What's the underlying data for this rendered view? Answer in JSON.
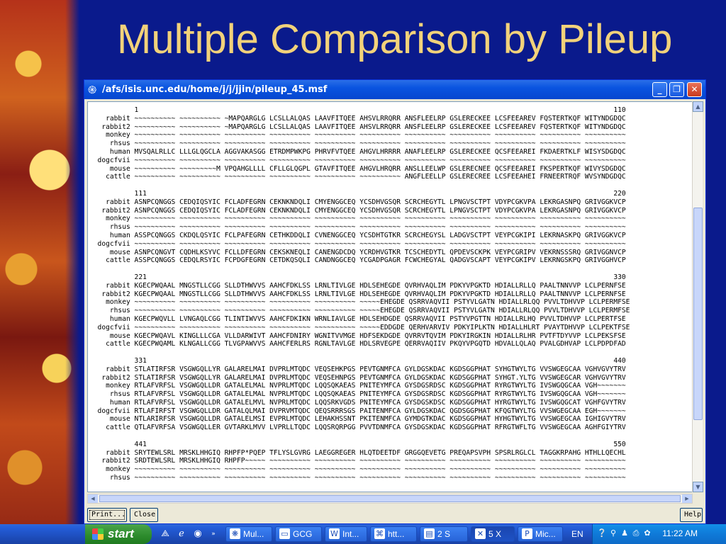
{
  "slide": {
    "title": "Multiple Comparison by Pileup"
  },
  "window": {
    "title": "/afs/isis.unc.edu/home/j/j/jjin/pileup_45.msf",
    "buttons": {
      "minimize": "_",
      "maximize": "❐",
      "close": "✕"
    }
  },
  "alignment": {
    "blocks": [
      {
        "start": "1",
        "end": "110",
        "rows": [
          [
            "rabbit",
            "~~~~~~~~~~ ~~~~~~~~~~ ~MAPQARGLG LCSLLALQAS LAAVFITQEE AHSVLRRQRR ANSFLEELRP GSLERECKEE LCSFEEAREV FQSTERTKQF WITYNDGDQC"
          ],
          [
            "rabbit2",
            "~~~~~~~~~~ ~~~~~~~~~~ ~MAPQARGLG LCSLLALQAS LAAVFITQEE AHSVLRRQRR ANSFLEELRP GSLERECKEE LCSFEEAREV FQSTERTKQF WITYNDGDQC"
          ],
          [
            "monkey",
            "~~~~~~~~~~ ~~~~~~~~~~ ~~~~~~~~~~ ~~~~~~~~~~ ~~~~~~~~~~ ~~~~~~~~~~ ~~~~~~~~~~ ~~~~~~~~~~ ~~~~~~~~~~ ~~~~~~~~~~ ~~~~~~~~~~"
          ],
          [
            "rhsus",
            "~~~~~~~~~~ ~~~~~~~~~~ ~~~~~~~~~~ ~~~~~~~~~~ ~~~~~~~~~~ ~~~~~~~~~~ ~~~~~~~~~~ ~~~~~~~~~~ ~~~~~~~~~~ ~~~~~~~~~~ ~~~~~~~~~~"
          ],
          [
            "human",
            "MVSQALRLLC LLLGLQGCLA AGGVAKASGG ETRDMPWKPG PHRVFVTQEE AHGVLHRRRR ANAFLEELRP GSLERECKEE QCSFEEAREI FKDAERTKLF WISYSDGDQC"
          ],
          [
            "dogcfvii",
            "~~~~~~~~~~ ~~~~~~~~~~ ~~~~~~~~~~ ~~~~~~~~~~ ~~~~~~~~~~ ~~~~~~~~~~ ~~~~~~~~~~ ~~~~~~~~~~ ~~~~~~~~~~ ~~~~~~~~~~ ~~~~~~~~~~"
          ],
          [
            "mouse",
            "~~~~~~~~~~ ~~~~~~~~~M VPQAHGLLLL CFLLGLQGPL GTAVFITQEE AHGVLHRQRR ANSLLEELWP GSLERECNEE QCSFEEAREI FKSPERTKQF WIVYSDGDQC"
          ],
          [
            "cattle",
            "~~~~~~~~~~ ~~~~~~~~~~ ~~~~~~~~~~ ~~~~~~~~~~ ~~~~~~~~~~ ~~~~~~~~~~ ANGFLEELLP GSLERECREE LCSFEEAHEI FRNEERTRQF WVSYNDGDQC"
          ]
        ]
      },
      {
        "start": "111",
        "end": "220",
        "rows": [
          [
            "rabbit",
            "ASNPCQNGGS CEDQIQSYIC FCLADFEGRN CEKNKNDQLI CMYENGGCEQ YCSDHVGSQR SCRCHEGYTL LPNGVSCTPT VDYPCGKVPA LEKRGASNPQ GRIVGGKVCP"
          ],
          [
            "rabbit2",
            "ASNPCQNGGS CEDQIQSYIC FCLADFEGRN CEKNKNDQLI CMYENGGCEQ YCSDHVGSQR SCRCHEGYTL LPNGVSCTPT VDYPCGKVPA LEKRGASNPQ GRIVGGKVCP"
          ],
          [
            "monkey",
            "~~~~~~~~~~ ~~~~~~~~~~ ~~~~~~~~~~ ~~~~~~~~~~ ~~~~~~~~~~ ~~~~~~~~~~ ~~~~~~~~~~ ~~~~~~~~~~ ~~~~~~~~~~ ~~~~~~~~~~ ~~~~~~~~~~"
          ],
          [
            "rhsus",
            "~~~~~~~~~~ ~~~~~~~~~~ ~~~~~~~~~~ ~~~~~~~~~~ ~~~~~~~~~~ ~~~~~~~~~~ ~~~~~~~~~~ ~~~~~~~~~~ ~~~~~~~~~~ ~~~~~~~~~~ ~~~~~~~~~~"
          ],
          [
            "human",
            "ASSPCQNGGS CKDQLQSYIC FCLPAFEGRN CETHKDDQLI CVNENGGCEQ YCSDHTGTKR SCRCHEGYSL LADGVSCTPT VEYPCGKIPI LEKRNASKPQ GRIVGGKVCP"
          ],
          [
            "dogcfvii",
            "~~~~~~~~~~ ~~~~~~~~~~ ~~~~~~~~~~ ~~~~~~~~~~ ~~~~~~~~~~ ~~~~~~~~~~ ~~~~~~~~~~ ~~~~~~~~~~ ~~~~~~~~~~ ~~~~~~~~~~ ~~~~~~~~~~"
          ],
          [
            "mouse",
            "ASNPCQNGVT CQDHLKSYVC FCLLDFEGRN CEKSKNEQLI CANENGDCDQ YCRDHVGTKR TCSCHEDYTL QPDEVSCKPK VEYPCGRIPV VEKRNSSSRQ GRIVGGNVCP"
          ],
          [
            "cattle",
            "ASSPCQNGGS CEDQLRSYIC FCPDGFEGRN CETDKQSQLI CANDNGGCEQ YCGADPGAGR FCWCHEGYAL QADGVSCAPT VEYPCGKIPV LEKRNGSKPQ GRIVGGHVCP"
          ]
        ]
      },
      {
        "start": "221",
        "end": "330",
        "rows": [
          [
            "rabbit",
            "KGECPWQAAL MNGSTLLCGG SLLDTHWVVS AAHCFDKLSS LRNLTIVLGE HDLSEHEGDE QVRHVAQLIM PDKYVPGKTD HDIALLRLLQ PAALTNNVVP LCLPERNFSE"
          ],
          [
            "rabbit2",
            "KGECPWQAAL MNGSTLLCGG SLLDTHWVVS AAHCFDKLSS LRNLTIVLGE HDLSEHEGDE QVRHVAQLIM PDKYVPGKTD HDIALLRLLQ PAALTNNVVP LCLPERNFSE"
          ],
          [
            "monkey",
            "~~~~~~~~~~ ~~~~~~~~~~ ~~~~~~~~~~ ~~~~~~~~~~ ~~~~~~~~~~ ~~~~~EHEGDE QSRRVAQVII PSTYVLGATN HDIALLRLQQ PVVLTDHVVP LCLPERMFSE"
          ],
          [
            "rhsus",
            "~~~~~~~~~~ ~~~~~~~~~~ ~~~~~~~~~~ ~~~~~~~~~~ ~~~~~~~~~~ ~~~~~EHEGDE QSRRVAQVII PSTYVLGATN HDIALLRLQQ PVVLTDHVVP LCLPERMFSE"
          ],
          [
            "human",
            "KGECPWQVLL LVNGAQLCGG TLINTIWVVS AAHCFDKIKN WRNLIAVLGE HDLSEHDGDE QSRRVAQVII PSTYVPGTTN HDIALLRLHQ PVVLTDHVVP LCLPERTFSE"
          ],
          [
            "dogcfvii",
            "~~~~~~~~~~ ~~~~~~~~~~ ~~~~~~~~~~ ~~~~~~~~~~ ~~~~~~~~~~ ~~~~~EDDGDE QERHVARVIV PDKYIPLKTN HDIALLHLRT PVAYTDHVVP LCLPEKTFSE"
          ],
          [
            "mouse",
            "KGECPWQAVL KINGLLLCGA VLLDARWIVT AAHCFDNIRY WGNITVVMGE HDFSEKDGDE QVRRVTQVIM PDKYIRGKIN HDIALLRLHR PVTFTDYVVP LCLPEKSFSE"
          ],
          [
            "cattle",
            "KGECPWQAML KLNGALLCGG TLVGPAWVVS AAHCFERLRS RGNLTAVLGE HDLSRVEGPE QERRVAQIIV PKQYVPGQTD HDVALLQLAQ PVALGDHVAP LCLPDPDFAD"
          ]
        ]
      },
      {
        "start": "331",
        "end": "440",
        "rows": [
          [
            "rabbit",
            "STLATIRFSR VSGWGQLLYR GALARELMAI DVPRLMTQDC VEQSEHKPGS PEVTGNMFCA GYLDGSKDAC KGDSGGPHAT SYHGTWYLTG VVSWGEGCAA VGHVGVYTRV"
          ],
          [
            "rabbit2",
            "STLATIRFSR VSGWGQLLYR GALARELMAI DVPRLMTQDC VEQSEHNPGS PEVTGNMFCA GYLDGSKDAC KGDSGGPHAT SYHGT.YLTG VVSWGEGCAR VGHVGVYTRV"
          ],
          [
            "monkey",
            "RTLAFVRFSL VSGWGQLLDR GATALELMAL NVPRLMTQDC LQQSQKAEAS PNITEYMFCA GYSDGSRDSC KGDSGGPHAT RYRGTWYLTG IVSWGQGCAA VGH~~~~~~~"
          ],
          [
            "rhsus",
            "RTLAFVRFSL VSGWGQLLDR GATALELMAL NVPRLMTQDC LQQSQKAEAS PNITEYMFCA GYSDGSRDSC KGDSGGPHAT RYRGTWYLTG IVSWGQGCAA VGH~~~~~~~"
          ],
          [
            "human",
            "RTLAFVRFSL VSGWGQLLDR GATALELMVL NVPRLMTQDC LQQSRKVGDS PNITEYMFCA GYSDGSKDSC KGDSGGPHAT HYRGTWYLTG IVSWGQGCAT VGHFGVYTRV"
          ],
          [
            "dogcfvii",
            "RTLAFIRFST VSGWGQLLDR GATALQLMAI DVPRVMTQDC QEQSRRRSGS PAITENMFCA GYLDGSKDAC QGDSGGPHAT KFQGTWYLTG VVSWGEGCAA EGH~~~~~~~"
          ],
          [
            "mouse",
            "NTLARIRFSR VSGWGQLLDR GATALELMSI EVPRLMTQDC LEHAKHSSNT PKITENMFCA GYMDGTKDAC KGDSGGPHAT HYHGTWYLTG VVSWGEGCAA IGHIGVYTRV"
          ],
          [
            "cattle",
            "QTLAFVRFSA VSGWGQLLER GVTARKLMVV LVPRLLTQDC LQQSRQRPGG PVVTDNMFCA GYSDGSKDAC KGDSGGPHAT RFRGTWFLTG VVSWGEGCAA AGHFGIYTRV"
          ]
        ]
      },
      {
        "start": "441",
        "end": "550",
        "rows": [
          [
            "rabbit",
            "SRYTEWLSRL MRSKLHHGIQ RHPFP*PQEP TFLYSLGVRG LAEGGREGER HLQTDEETDF GRGGQEVETG PREQAPSVPH SPSRLRGLCL TAGGKRPAHG HTHLLQECHL"
          ],
          [
            "rabbit2",
            "SRDTEWLSRL MRSKLHHGIQ RHPFP~~~~~ ~~~~~~~~~~ ~~~~~~~~~~ ~~~~~~~~~~ ~~~~~~~~~~ ~~~~~~~~~~ ~~~~~~~~~~ ~~~~~~~~~~ ~~~~~~~~~~"
          ],
          [
            "monkey",
            "~~~~~~~~~~ ~~~~~~~~~~ ~~~~~~~~~~ ~~~~~~~~~~ ~~~~~~~~~~ ~~~~~~~~~~ ~~~~~~~~~~ ~~~~~~~~~~ ~~~~~~~~~~ ~~~~~~~~~~ ~~~~~~~~~~"
          ],
          [
            "rhsus",
            "~~~~~~~~~~ ~~~~~~~~~~ ~~~~~~~~~~ ~~~~~~~~~~ ~~~~~~~~~~ ~~~~~~~~~~ ~~~~~~~~~~ ~~~~~~~~~~ ~~~~~~~~~~ ~~~~~~~~~~ ~~~~~~~~~~"
          ]
        ]
      }
    ]
  },
  "dialog_buttons": {
    "print": "Print...",
    "close": "Close",
    "help": "Help"
  },
  "taskbar": {
    "start_label": "start",
    "tasks": [
      {
        "label": "Mul...",
        "icon": "❋"
      },
      {
        "label": "GCG",
        "icon": "▭"
      },
      {
        "label": "Int...",
        "icon": "W"
      },
      {
        "label": "htt...",
        "icon": "⌘"
      },
      {
        "label": "2 S",
        "icon": "▤"
      },
      {
        "label": "5 X",
        "icon": "✕"
      },
      {
        "label": "Mic...",
        "icon": "P"
      }
    ],
    "language": "EN",
    "clock": "11:22 AM"
  }
}
